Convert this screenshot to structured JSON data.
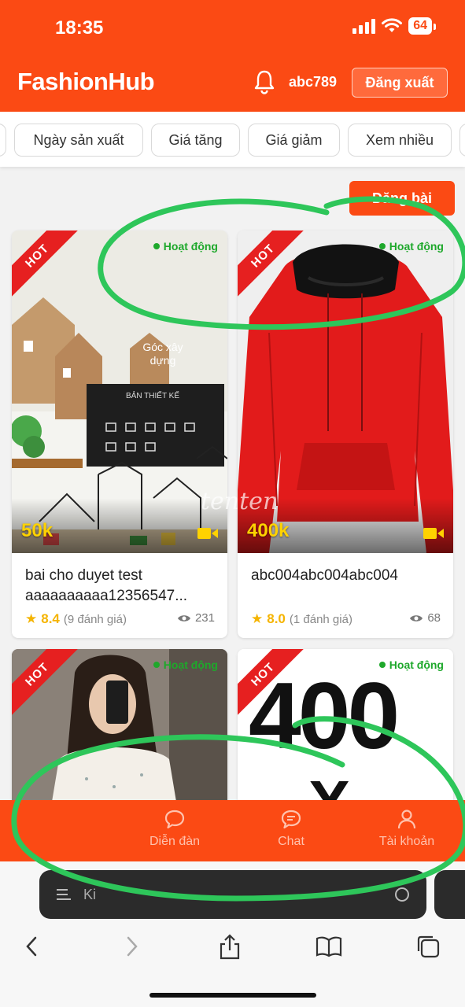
{
  "status_bar": {
    "time": "18:35",
    "battery": "64"
  },
  "header": {
    "app_title": "FashionHub",
    "username": "abc789",
    "logout_label": "Đăng xuất"
  },
  "filters": [
    "Ngày sản xuất",
    "Giá tăng",
    "Giá giảm",
    "Xem nhiều"
  ],
  "post_button_label": "Đăng bài",
  "products": [
    {
      "badge": "HOT",
      "status": "Hoạt động",
      "price": "50k",
      "title": "bai cho duyet test aaaaaaaaaa12356547...",
      "rating": "8.4",
      "review_count": "(9 đánh giá)",
      "views": "231",
      "image_text": {
        "sign": "Góc xây dựng",
        "board": "BẢN THIẾT KẾ"
      }
    },
    {
      "badge": "HOT",
      "status": "Hoạt động",
      "price": "400k",
      "title": "abc004abc004abc004",
      "rating": "8.0",
      "review_count": "(1 đánh giá)",
      "views": "68"
    },
    {
      "badge": "HOT",
      "status": "Hoạt động"
    },
    {
      "badge": "HOT",
      "status": "Hoạt động",
      "image_text": "400"
    }
  ],
  "watermark": "tenten",
  "bottom_nav": [
    {
      "label": "Diễn đàn",
      "icon": "forum-icon"
    },
    {
      "label": "Chat",
      "icon": "chat-icon"
    },
    {
      "label": "Tài khoản",
      "icon": "account-icon"
    }
  ],
  "safari": {
    "address_partial": "Ki"
  },
  "colors": {
    "brand": "#fb4a14",
    "active_status": "#1ea82b",
    "price": "#ffd200",
    "annotation": "#2ec65a"
  }
}
